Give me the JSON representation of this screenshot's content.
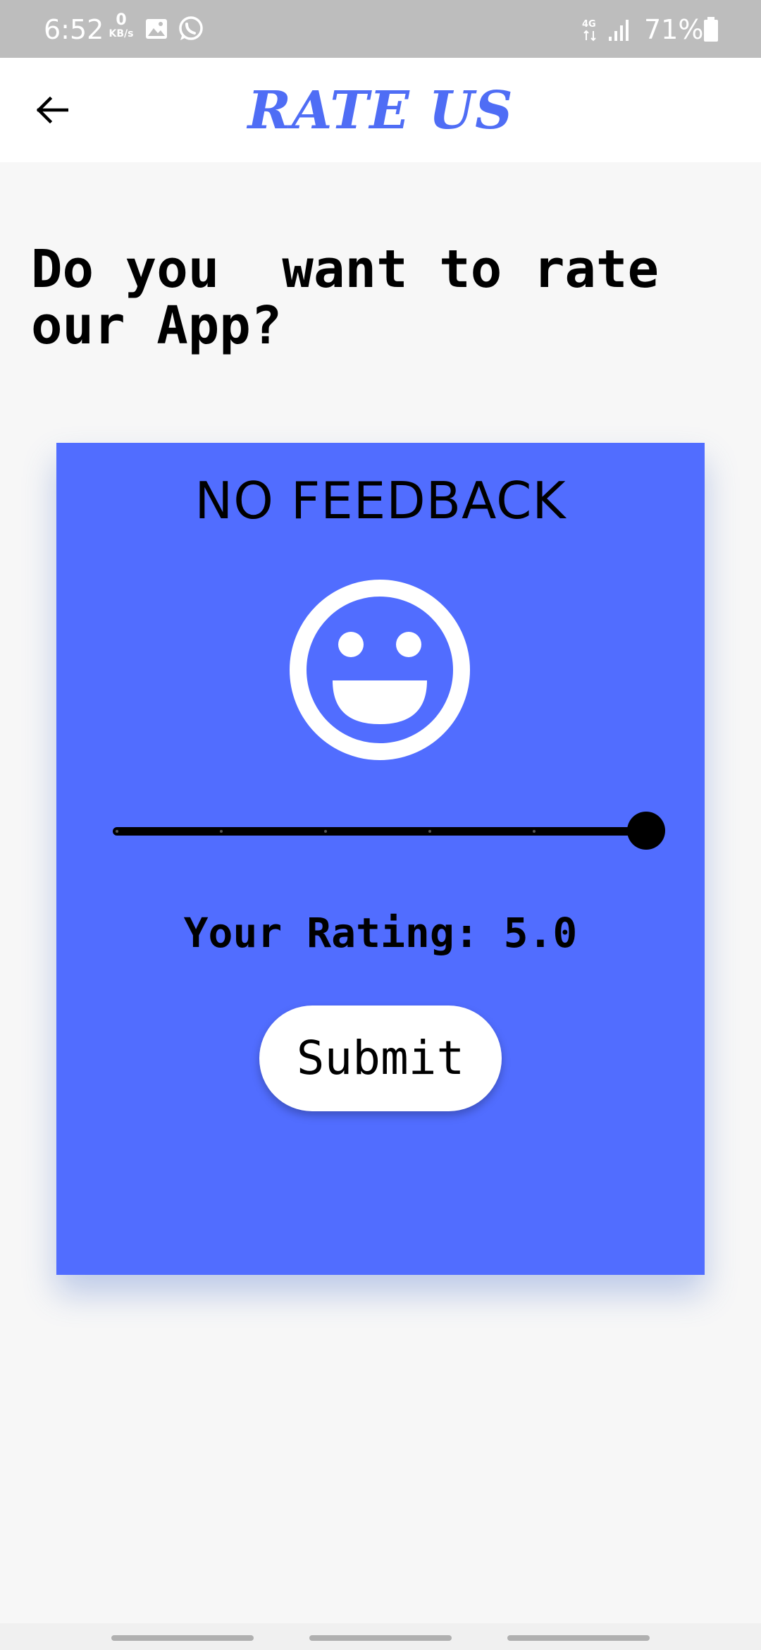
{
  "status_bar": {
    "time": "6:52",
    "data_speed_value": "0",
    "data_speed_unit": "KB/s",
    "network_type": "4G",
    "battery_percent": "71%"
  },
  "header": {
    "title": "RATE US",
    "back_icon": "arrow-left-icon"
  },
  "main": {
    "question": "Do you  want to rate our App?",
    "card": {
      "feedback_label": "NO FEEDBACK",
      "emoji_icon": "grinning-face-icon",
      "slider": {
        "value": 5.0,
        "min": 0,
        "max": 5
      },
      "rating_text": "Your Rating: 5.0",
      "submit_label": "Submit"
    }
  },
  "colors": {
    "accent": "#4f6df5",
    "card_background": "#516dff",
    "status_bar": "#bdbdbd"
  }
}
